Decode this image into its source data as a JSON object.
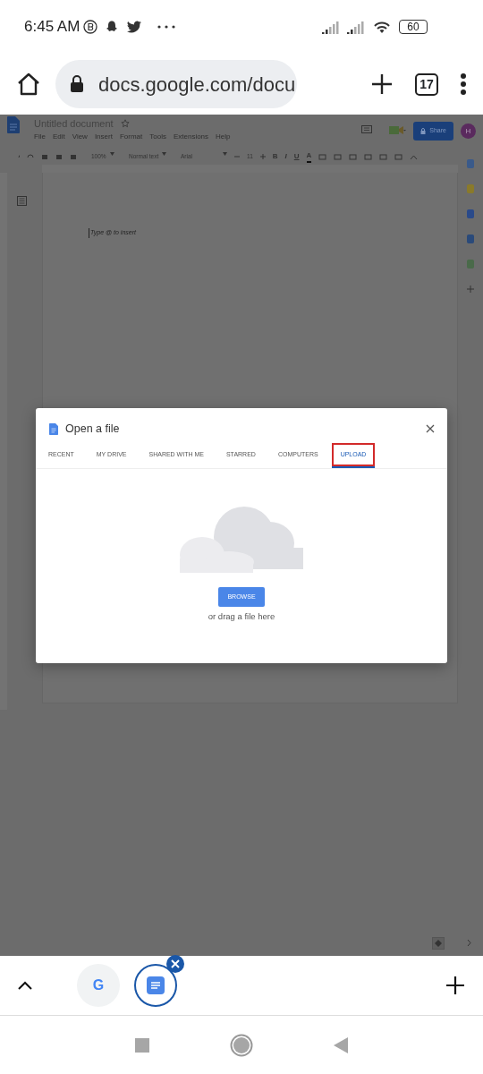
{
  "status_bar": {
    "time": "6:45 AM",
    "battery": "60"
  },
  "browser": {
    "url": "docs.google.com/docu",
    "tab_count": "17"
  },
  "document": {
    "title": "Untitled document",
    "menu": [
      "File",
      "Edit",
      "View",
      "Insert",
      "Format",
      "Tools",
      "Extensions",
      "Help"
    ],
    "share": "Share",
    "avatar": "H",
    "toolbar": {
      "zoom": "100%",
      "style": "Normal text",
      "font": "Arial",
      "size": "11",
      "format_buttons": [
        "B",
        "I",
        "U",
        "A"
      ]
    },
    "placeholder": "Type @ to insert"
  },
  "dialog": {
    "title": "Open a file",
    "tabs": [
      {
        "label": "RECENT",
        "selected": false,
        "highlighted": false
      },
      {
        "label": "MY DRIVE",
        "selected": false,
        "highlighted": false
      },
      {
        "label": "SHARED WITH ME",
        "selected": false,
        "highlighted": false
      },
      {
        "label": "STARRED",
        "selected": false,
        "highlighted": false
      },
      {
        "label": "COMPUTERS",
        "selected": false,
        "highlighted": false
      },
      {
        "label": "UPLOAD",
        "selected": true,
        "highlighted": true
      }
    ],
    "browse": "BROWSE",
    "hint": "or drag a file here"
  },
  "tab_strip": [
    {
      "kind": "google",
      "label": "G",
      "selected": false
    },
    {
      "kind": "docs",
      "selected": true
    }
  ]
}
